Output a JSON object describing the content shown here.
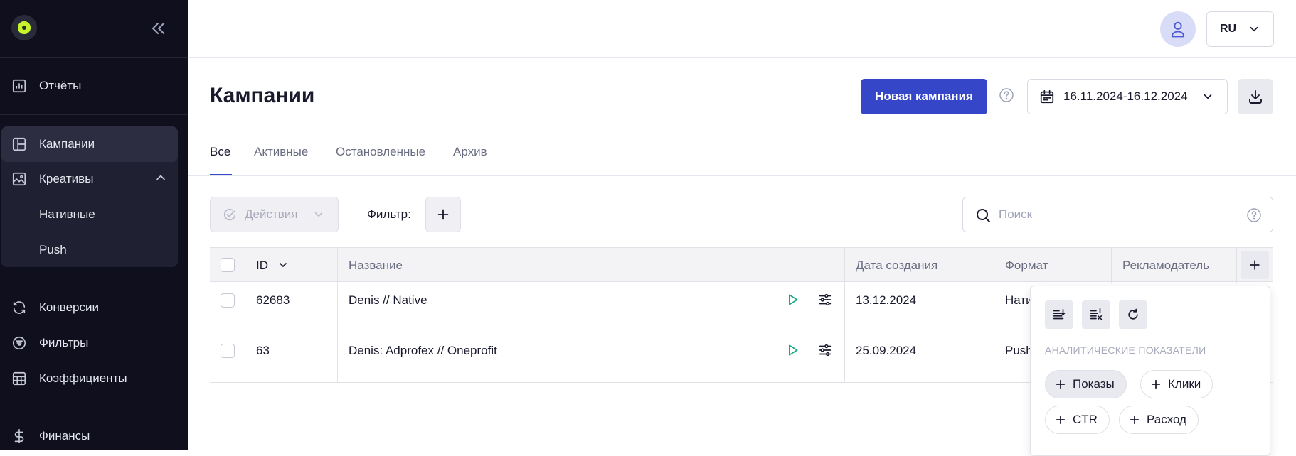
{
  "sidebar": {
    "items": [
      {
        "label": "Отчёты",
        "icon": "chart-icon"
      },
      {
        "label": "Кампании",
        "icon": "layout-icon"
      },
      {
        "label": "Креативы",
        "icon": "image-icon"
      },
      {
        "label": "Конверсии",
        "icon": "refresh-icon"
      },
      {
        "label": "Фильтры",
        "icon": "filter-icon"
      },
      {
        "label": "Коэффициенты",
        "icon": "grid-icon"
      },
      {
        "label": "Финансы",
        "icon": "dollar-icon"
      }
    ],
    "sub_items": [
      "Нативные",
      "Push"
    ]
  },
  "topbar": {
    "lang": "RU"
  },
  "header": {
    "title": "Кампании",
    "new_button": "Новая кампания",
    "date_range": "16.11.2024-16.12.2024"
  },
  "tabs": [
    "Все",
    "Активные",
    "Остановленные",
    "Архив"
  ],
  "toolbar": {
    "actions": "Действия",
    "filter_label": "Фильтр:",
    "search_placeholder": "Поиск"
  },
  "table": {
    "columns": {
      "id": "ID",
      "name": "Название",
      "created": "Дата создания",
      "format": "Формат",
      "advertiser": "Рекламодатель"
    },
    "rows": [
      {
        "id": "62683",
        "name": "Denis // Native",
        "created": "13.12.2024",
        "format": "Нати"
      },
      {
        "id": "63",
        "name": "Denis: Adprofex // Oneprofit",
        "created": "25.09.2024",
        "format": "Push"
      }
    ]
  },
  "column_popup": {
    "section_title": "АНАЛИТИЧЕСКИЕ ПОКАЗАТЕЛИ",
    "chips": [
      "Показы",
      "Клики",
      "CTR",
      "Расход"
    ]
  },
  "colors": {
    "accent": "#3546c8",
    "sidebar_bg": "#0f0f1e",
    "play_green": "#16a884",
    "logo_lime": "#c6f32a"
  }
}
